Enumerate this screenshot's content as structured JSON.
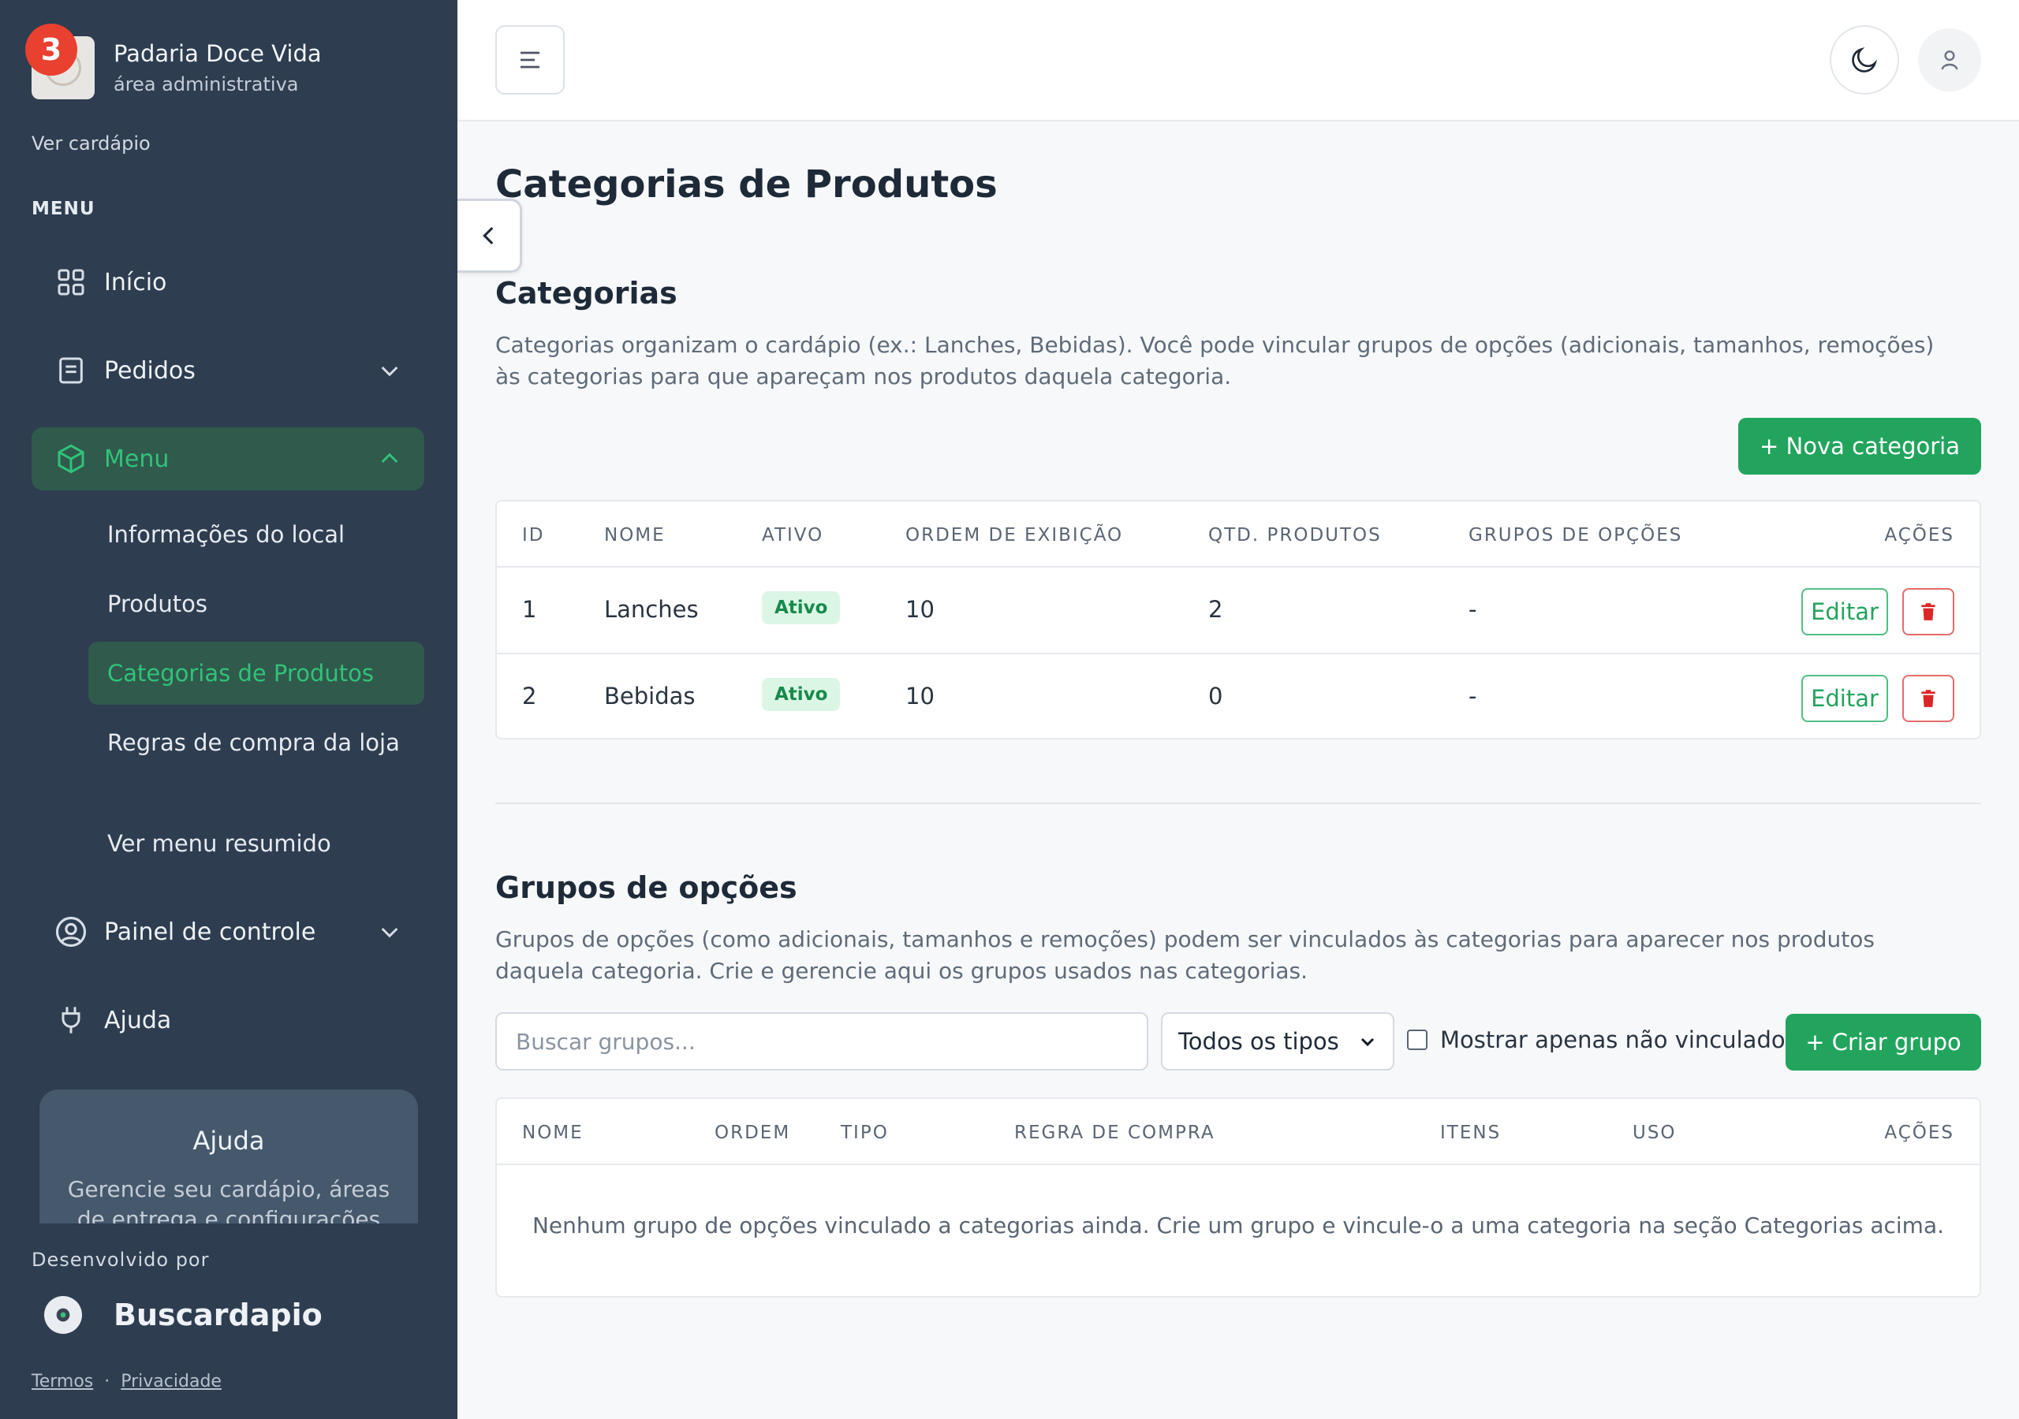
{
  "brand": {
    "name": "Padaria Doce Vida",
    "subtitle": "área administrativa",
    "notification_count": "3"
  },
  "sidebar": {
    "view_menu_link": "Ver cardápio",
    "menu_label": "MENU",
    "items": [
      {
        "label": "Início",
        "icon": "grid-icon"
      },
      {
        "label": "Pedidos",
        "icon": "receipt-icon"
      },
      {
        "label": "Menu",
        "icon": "box-icon"
      },
      {
        "label": "Painel de controle",
        "icon": "user-circle-icon"
      },
      {
        "label": "Ajuda",
        "icon": "plug-icon"
      }
    ],
    "submenu": [
      {
        "label": "Informações do local"
      },
      {
        "label": "Produtos"
      },
      {
        "label": "Categorias de Produtos"
      },
      {
        "label": "Regras de compra da loja"
      },
      {
        "label": "Ver menu resumido"
      }
    ],
    "help_card": {
      "title": "Ajuda",
      "text": "Gerencie seu cardápio, áreas de entrega e configurações da"
    },
    "developed_by": "Desenvolvido por",
    "developer_name": "Buscardapio",
    "terms": "Termos",
    "separator": "·",
    "privacy": "Privacidade"
  },
  "page": {
    "title": "Categorias de Produtos"
  },
  "categories": {
    "title": "Categorias",
    "description": "Categorias organizam o cardápio (ex.: Lanches, Bebidas). Você pode vincular grupos de opções (adicionais, tamanhos, remoções) às categorias para que apareçam nos produtos daquela categoria.",
    "new_button": "+ Nova categoria",
    "columns": [
      "ID",
      "NOME",
      "ATIVO",
      "ORDEM DE EXIBIÇÃO",
      "QTD. PRODUTOS",
      "GRUPOS DE OPÇÕES",
      "AÇÕES"
    ],
    "rows": [
      {
        "id": "1",
        "name": "Lanches",
        "status": "Ativo",
        "order": "10",
        "products": "2",
        "groups": "-",
        "edit": "Editar"
      },
      {
        "id": "2",
        "name": "Bebidas",
        "status": "Ativo",
        "order": "10",
        "products": "0",
        "groups": "-",
        "edit": "Editar"
      }
    ]
  },
  "option_groups": {
    "title": "Grupos de opções",
    "description": "Grupos de opções (como adicionais, tamanhos e remoções) podem ser vinculados às categorias para aparecer nos produtos daquela categoria. Crie e gerencie aqui os grupos usados nas categorias.",
    "search_placeholder": "Buscar grupos...",
    "type_filter": "Todos os tipos",
    "unlinked_only_label": "Mostrar apenas não vinculados",
    "create_button": "+ Criar grupo",
    "columns": [
      "NOME",
      "ORDEM",
      "TIPO",
      "REGRA DE COMPRA",
      "ITENS",
      "USO",
      "AÇÕES"
    ],
    "empty_message": "Nenhum grupo de opções vinculado a categorias ainda. Crie um grupo e vincule-o a uma categoria na seção Categorias acima."
  },
  "colors": {
    "sidebar": "#2e3d50",
    "accent": "#22a45d",
    "danger": "#dc2626",
    "active_bg": "#2f5a4c"
  }
}
